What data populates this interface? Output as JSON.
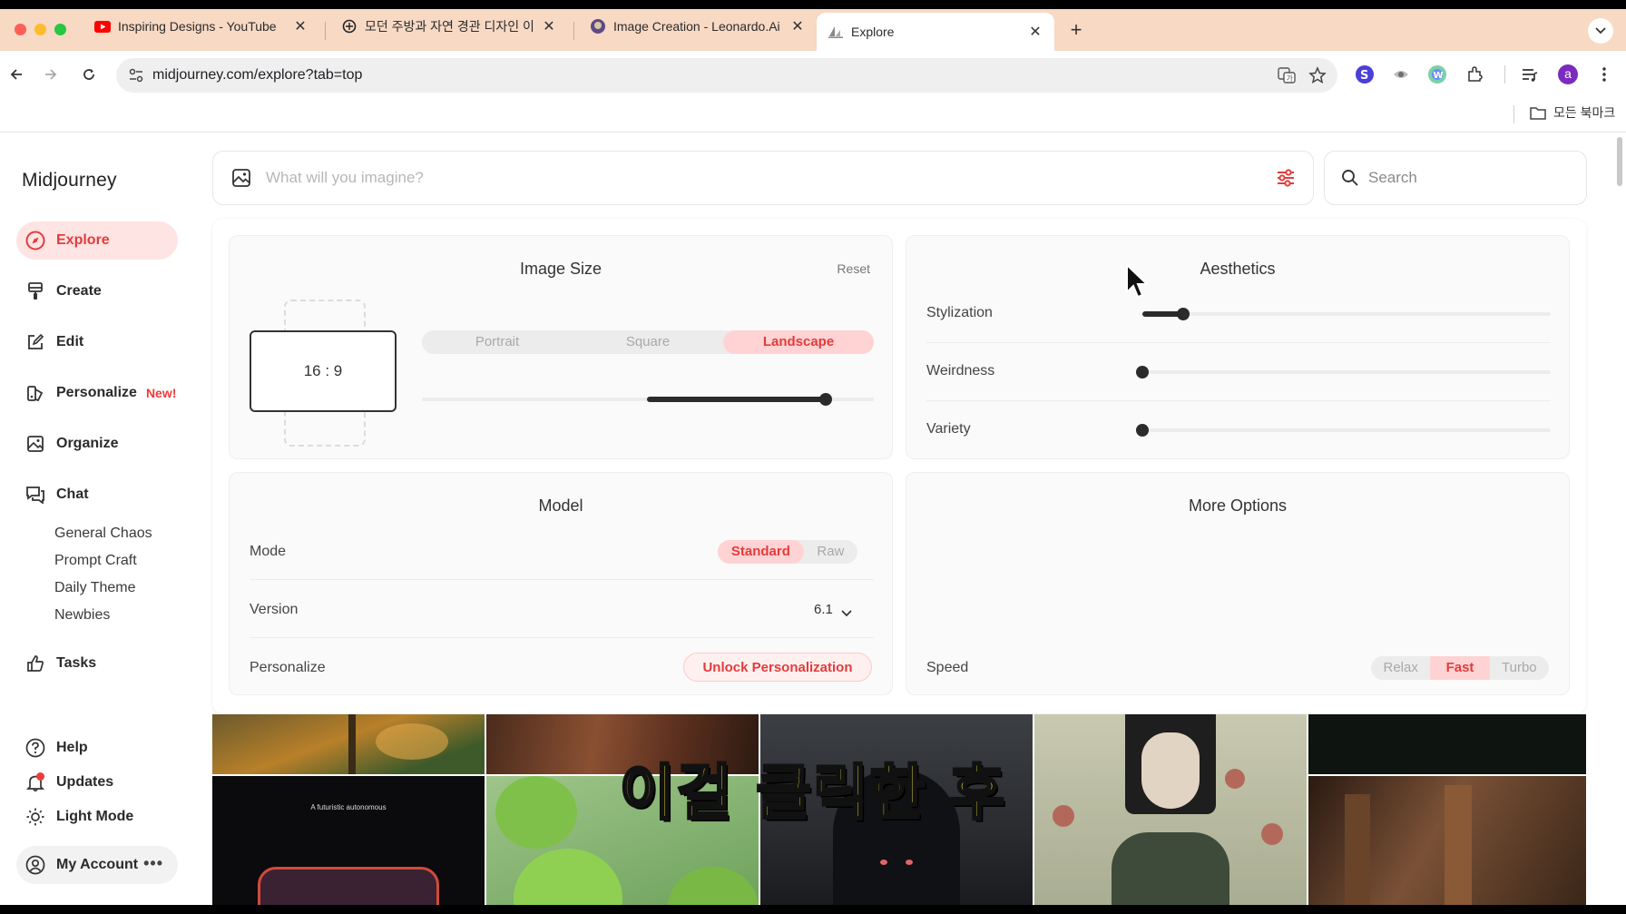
{
  "browser": {
    "tabs": [
      {
        "title": "Inspiring Designs - YouTube",
        "icon": "youtube-icon"
      },
      {
        "title": "모던 주방과 자연 경관 디자인 이미",
        "icon": "chatgpt-icon"
      },
      {
        "title": "Image Creation - Leonardo.Ai",
        "icon": "leonardo-icon"
      },
      {
        "title": "Explore",
        "icon": "midjourney-icon",
        "active": true
      }
    ],
    "url": "midjourney.com/explore?tab=top",
    "bookmarks_folder": "모든 북마크",
    "profile_initial": "a"
  },
  "sidebar": {
    "brand": "Midjourney",
    "items": [
      {
        "label": "Explore",
        "icon": "compass-icon",
        "active": true
      },
      {
        "label": "Create",
        "icon": "brush-icon"
      },
      {
        "label": "Edit",
        "icon": "edit-icon"
      },
      {
        "label": "Personalize",
        "icon": "personalize-icon",
        "badge": "New!"
      },
      {
        "label": "Organize",
        "icon": "image-icon"
      },
      {
        "label": "Chat",
        "icon": "chat-icon"
      }
    ],
    "chat_channels": [
      "General Chaos",
      "Prompt Craft",
      "Daily Theme",
      "Newbies"
    ],
    "tasks": "Tasks",
    "help": "Help",
    "updates": "Updates",
    "light_mode": "Light Mode",
    "account": "My Account"
  },
  "imagine": {
    "placeholder": "What will you imagine?"
  },
  "search": {
    "placeholder": "Search"
  },
  "image_size": {
    "title": "Image Size",
    "reset": "Reset",
    "ratio": "16 : 9",
    "orientations": [
      "Portrait",
      "Square",
      "Landscape"
    ],
    "selected": "Landscape",
    "slider_fraction": 0.9
  },
  "aesthetics": {
    "title": "Aesthetics",
    "stylization": {
      "label": "Stylization",
      "value_fraction": 0.1
    },
    "weirdness": {
      "label": "Weirdness",
      "value_fraction": 0.0
    },
    "variety": {
      "label": "Variety",
      "value_fraction": 0.0
    }
  },
  "model": {
    "title": "Model",
    "mode_label": "Mode",
    "modes": [
      "Standard",
      "Raw"
    ],
    "mode_selected": "Standard",
    "version_label": "Version",
    "version_value": "6.1",
    "personalize_label": "Personalize",
    "personalize_button": "Unlock Personalization"
  },
  "more_options": {
    "title": "More Options",
    "speed_label": "Speed",
    "speeds": [
      "Relax",
      "Fast",
      "Turbo"
    ],
    "speed_selected": "Fast"
  },
  "gallery": {
    "tile_text": "A futuristic autonomous"
  },
  "caption": "이걸 클릭한 후",
  "colors": {
    "accent": "#e23c3c",
    "accent_bg": "#ffe4e4"
  }
}
